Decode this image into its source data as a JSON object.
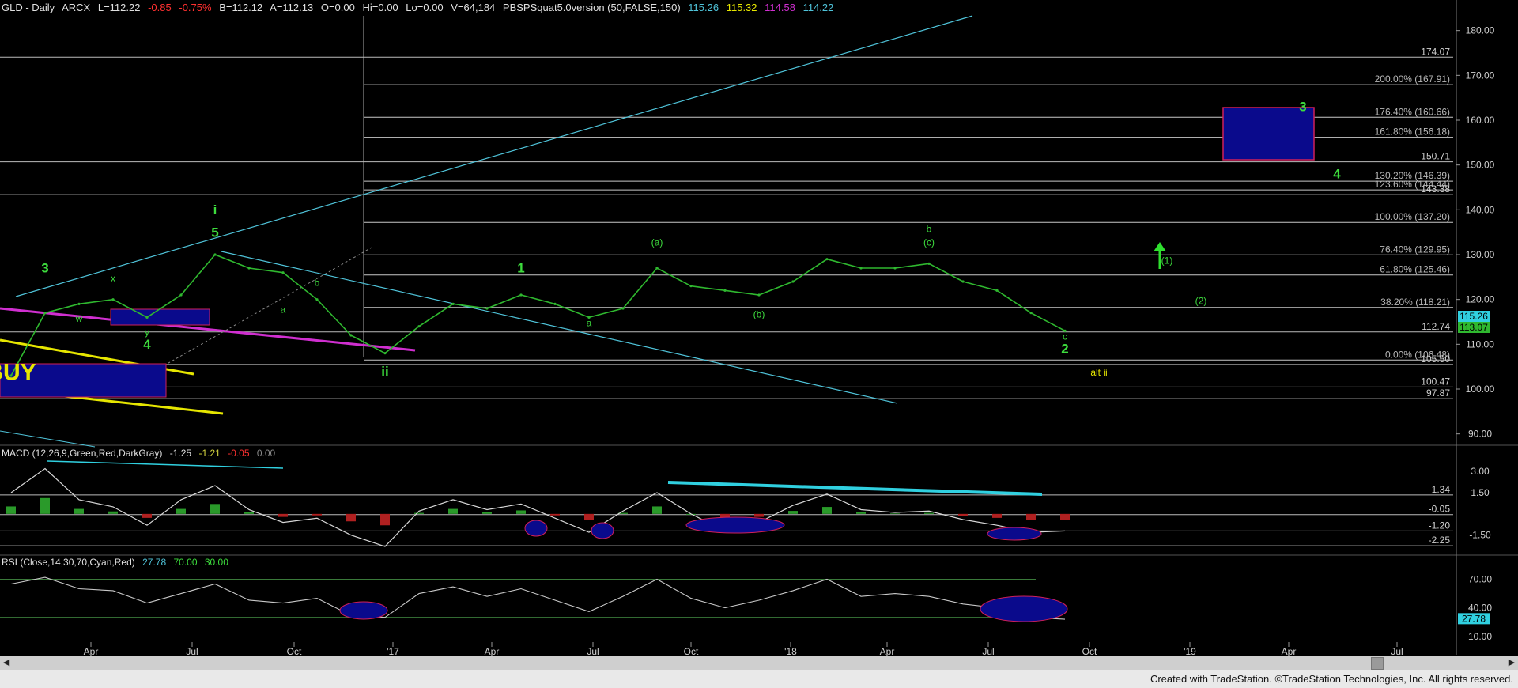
{
  "header": {
    "symbol": "GLD - Daily",
    "exchange": "ARCX",
    "last": "L=112.22",
    "change": "-0.85",
    "change_pct": "-0.75%",
    "bid": "B=112.12",
    "ask": "A=112.13",
    "open": "O=0.00",
    "high": "Hi=0.00",
    "low": "Lo=0.00",
    "volume": "V=64,184",
    "study": "PBSPSquat5.0version (50,FALSE,150)",
    "study_values": [
      "115.26",
      "115.32",
      "114.58",
      "114.22"
    ]
  },
  "macd_header": {
    "label": "MACD (12,26,9,Green,Red,DarkGray)",
    "values": [
      "-1.25",
      "-1.21",
      "-0.05",
      "0.00"
    ]
  },
  "rsi_header": {
    "label": "RSI (Close,14,30,70,Cyan,Red)",
    "values": [
      "27.78",
      "70.00",
      "30.00"
    ]
  },
  "footer": {
    "credit": "Created with TradeStation. ©TradeStation Technologies, Inc. All rights reserved."
  },
  "colors": {
    "price": "#2fb82f",
    "fib": "#c8c8c8",
    "cyan": "#4fc3d9",
    "magenta": "#d02fd0",
    "yellow": "#e6e600",
    "blue_box": "#0a0a8c",
    "box_border": "#d0205a",
    "green_label": "#3ddc3d",
    "macd_pos": "#2a9a2a",
    "macd_neg": "#b02020",
    "macd_line": "#d8d8d8",
    "signal": "#d8d840",
    "rsi": "#c8c8c8",
    "ann_cyan": "#30d0e0",
    "tag_blue": "#0a0a8c"
  },
  "chart_data": [
    {
      "type": "line",
      "panel": "price",
      "series": [],
      "x": [
        "2016-01",
        "2016-02",
        "2016-03",
        "2016-04",
        "2016-05",
        "2016-06",
        "2016-07",
        "2016-08",
        "2016-09",
        "2016-10",
        "2016-11",
        "2016-12",
        "2017-01",
        "2017-02",
        "2017-03",
        "2017-04",
        "2017-05",
        "2017-06",
        "2017-07",
        "2017-08",
        "2017-09",
        "2017-10",
        "2017-11",
        "2017-12",
        "2018-01",
        "2018-02",
        "2018-03",
        "2018-04",
        "2018-05",
        "2018-06",
        "2018-07",
        "2018-08"
      ],
      "y": [
        103,
        117,
        119,
        120,
        116,
        121,
        130,
        127,
        126,
        120,
        112,
        108,
        114,
        119,
        118,
        121,
        119,
        116,
        118,
        127,
        123,
        122,
        121,
        124,
        129,
        127,
        127,
        128,
        124,
        122,
        117,
        113
      ],
      "ylim": [
        88,
        184
      ],
      "y_ticks": [
        90,
        100,
        110,
        120,
        130,
        140,
        150,
        160,
        170,
        180
      ],
      "x_ticks": [
        "Apr",
        "Jul",
        "Oct",
        "'17",
        "Apr",
        "Jul",
        "Oct",
        "'18",
        "Apr",
        "Jul",
        "Oct",
        "'19",
        "Apr",
        "Jul"
      ],
      "fib_levels": [
        {
          "label": "200.00% (167.91)",
          "value": 167.91
        },
        {
          "label": "176.40% (160.66)",
          "value": 160.66
        },
        {
          "label": "161.80% (156.18)",
          "value": 156.18
        },
        {
          "label": "130.20% (146.39)",
          "value": 146.39
        },
        {
          "label": "123.60% (144.44)",
          "value": 144.44
        },
        {
          "label": "100.00% (137.20)",
          "value": 137.2
        },
        {
          "label": "76.40% (129.95)",
          "value": 129.95
        },
        {
          "label": "61.80% (125.46)",
          "value": 125.46
        },
        {
          "label": "38.20% (118.21)",
          "value": 118.21
        },
        {
          "label": "0.00% (106.48)",
          "value": 106.48
        }
      ],
      "levels": [
        {
          "label": "174.07",
          "value": 174.07
        },
        {
          "label": "150.71",
          "value": 150.71
        },
        {
          "label": "143.38",
          "value": 143.38
        },
        {
          "label": "112.74",
          "value": 112.74
        },
        {
          "label": "105.50",
          "value": 105.5
        },
        {
          "label": "100.47",
          "value": 100.47
        },
        {
          "label": "97.87",
          "value": 97.87
        }
      ],
      "price_tags": [
        "115.26",
        "113.07"
      ],
      "annotations": [
        {
          "text": "BUY",
          "x": "2016-01",
          "y": 102
        },
        {
          "text": "3",
          "x": "2016-02",
          "y": 126
        },
        {
          "text": "w",
          "x": "2016-03",
          "y": 115
        },
        {
          "text": "x",
          "x": "2016-04",
          "y": 124
        },
        {
          "text": "y",
          "x": "2016-05",
          "y": 112
        },
        {
          "text": "4",
          "x": "2016-05",
          "y": 109
        },
        {
          "text": "5",
          "x": "2016-07",
          "y": 134
        },
        {
          "text": "i",
          "x": "2016-07",
          "y": 139
        },
        {
          "text": "b",
          "x": "2016-10",
          "y": 123
        },
        {
          "text": "a",
          "x": "2016-09",
          "y": 117
        },
        {
          "text": "ii",
          "x": "2016-12",
          "y": 103
        },
        {
          "text": "1",
          "x": "2017-04",
          "y": 126
        },
        {
          "text": "a",
          "x": "2017-06",
          "y": 114
        },
        {
          "text": "(a)",
          "x": "2017-08",
          "y": 132
        },
        {
          "text": "(b)",
          "x": "2017-11",
          "y": 116
        },
        {
          "text": "b",
          "x": "2018-04",
          "y": 135
        },
        {
          "text": "(c)",
          "x": "2018-04",
          "y": 132
        },
        {
          "text": "c",
          "x": "2018-08",
          "y": 111
        },
        {
          "text": "2",
          "x": "2018-08",
          "y": 108
        },
        {
          "text": "alt ii",
          "x": "2018-09",
          "y": 103
        },
        {
          "text": "(1)",
          "x": "2018-11",
          "y": 128
        },
        {
          "text": "(2)",
          "x": "2018-12",
          "y": 119
        },
        {
          "text": "3",
          "x": "2019-03",
          "y": 162
        },
        {
          "text": "4",
          "x": "2019-04",
          "y": 147
        }
      ]
    },
    {
      "type": "bar",
      "panel": "macd",
      "series": [],
      "ylim": [
        -2.8,
        3.9
      ],
      "y_ticks": [
        3.0,
        1.5,
        -1.5
      ],
      "levels": [
        {
          "label": "1.34",
          "value": 1.34
        },
        {
          "label": "-0.05",
          "value": -0.05
        },
        {
          "label": "-1.20",
          "value": -1.2
        },
        {
          "label": "-2.25",
          "value": -2.25
        }
      ],
      "x": [
        "2016-01",
        "2016-02",
        "2016-03",
        "2016-04",
        "2016-05",
        "2016-06",
        "2016-07",
        "2016-08",
        "2016-09",
        "2016-10",
        "2016-11",
        "2016-12",
        "2017-01",
        "2017-02",
        "2017-03",
        "2017-04",
        "2017-05",
        "2017-06",
        "2017-07",
        "2017-08",
        "2017-09",
        "2017-10",
        "2017-11",
        "2017-12",
        "2018-01",
        "2018-02",
        "2018-03",
        "2018-04",
        "2018-05",
        "2018-06",
        "2018-07",
        "2018-08"
      ],
      "y": [
        1.5,
        3.2,
        1.0,
        0.5,
        -0.8,
        1.0,
        2.0,
        0.3,
        -0.6,
        -0.3,
        -1.5,
        -2.3,
        0.2,
        1.0,
        0.3,
        0.7,
        -0.3,
        -1.3,
        0.2,
        1.5,
        0.0,
        -1.2,
        -0.6,
        0.6,
        1.4,
        0.3,
        0.1,
        0.2,
        -0.4,
        -0.8,
        -1.3,
        -1.2
      ]
    },
    {
      "type": "line",
      "panel": "rsi",
      "series": [],
      "ylim": [
        4,
        82
      ],
      "y_ticks": [
        70.0,
        40.0,
        10.0
      ],
      "levels": [
        {
          "label": "70.00",
          "value": 70
        },
        {
          "label": "30.00",
          "value": 30
        }
      ],
      "price_tags": [
        "27.78"
      ],
      "x": [
        "2016-01",
        "2016-02",
        "2016-03",
        "2016-04",
        "2016-05",
        "2016-06",
        "2016-07",
        "2016-08",
        "2016-09",
        "2016-10",
        "2016-11",
        "2016-12",
        "2017-01",
        "2017-02",
        "2017-03",
        "2017-04",
        "2017-05",
        "2017-06",
        "2017-07",
        "2017-08",
        "2017-09",
        "2017-10",
        "2017-11",
        "2017-12",
        "2018-01",
        "2018-02",
        "2018-03",
        "2018-04",
        "2018-05",
        "2018-06",
        "2018-07",
        "2018-08"
      ],
      "y": [
        65,
        72,
        60,
        58,
        45,
        55,
        65,
        48,
        45,
        50,
        32,
        30,
        55,
        62,
        52,
        60,
        48,
        36,
        52,
        70,
        50,
        40,
        48,
        58,
        70,
        52,
        55,
        52,
        44,
        40,
        30,
        28
      ]
    }
  ]
}
